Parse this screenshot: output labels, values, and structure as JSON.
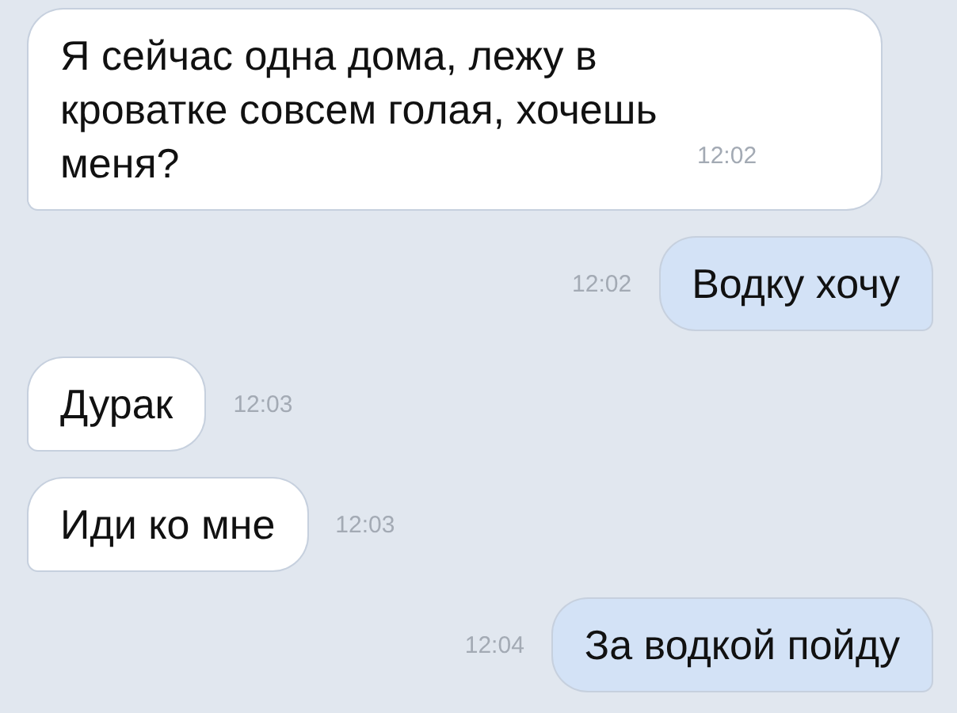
{
  "messages": [
    {
      "kind": "incoming",
      "text": "Я сейчас одна дома, лежу в кроватке совсем голая, хочешь меня?",
      "time": "12:02",
      "time_inside": true
    },
    {
      "kind": "outgoing",
      "text": "Водку хочу",
      "time": "12:02",
      "time_inside": false
    },
    {
      "kind": "incoming",
      "text": "Дурак",
      "time": "12:03",
      "time_inside": false
    },
    {
      "kind": "incoming",
      "text": "Иди ко мне",
      "time": "12:03",
      "time_inside": false
    },
    {
      "kind": "outgoing",
      "text": "За водкой пойду",
      "time": "12:04",
      "time_inside": false
    }
  ]
}
